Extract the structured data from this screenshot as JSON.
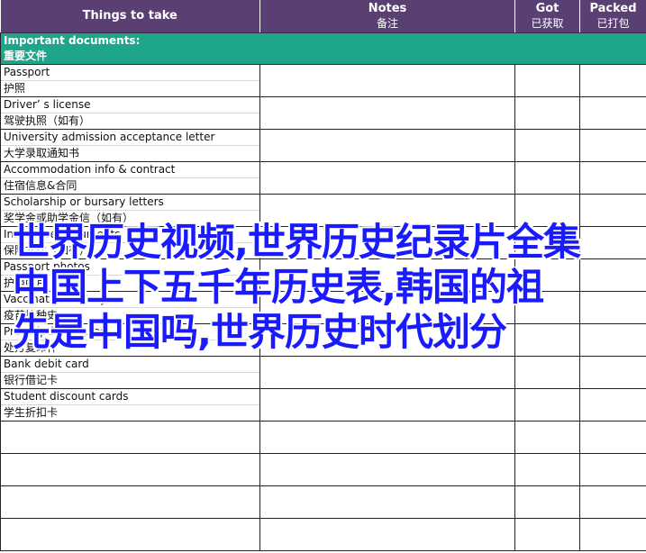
{
  "header": {
    "col1": "Things to take",
    "col2": "Notes",
    "col2_zh": "备注",
    "col3": "Got",
    "col3_zh": "已获取",
    "col4": "Packed",
    "col4_zh": "已打包"
  },
  "section": {
    "title": "Important documents:",
    "title_zh": "重要文件"
  },
  "items": [
    {
      "en": "Passport",
      "zh": "护照"
    },
    {
      "en": "Driver’ s license",
      "zh": "驾驶执照（如有）"
    },
    {
      "en": "University admission acceptance letter",
      "zh": "大学录取通知书"
    },
    {
      "en": "Accommodation info & contract",
      "zh": "住宿信息&合同"
    },
    {
      "en": "Scholarship or bursary letters",
      "zh": "奖学金或助学金信（如有）"
    },
    {
      "en": "Insurance documents",
      "zh": "保险文件（如有）"
    },
    {
      "en": "Passport photos",
      "zh": "护照照片"
    },
    {
      "en": "Vaccination history",
      "zh": "疫苗接种史"
    },
    {
      "en": "Prescription copies",
      "zh": "处方复印件"
    },
    {
      "en": "Bank debit card",
      "zh": "银行借记卡"
    },
    {
      "en": "Student discount cards",
      "zh": "学生折扣卡"
    }
  ],
  "overlay": {
    "line1": "世界历史视频,世界历史纪录片全集",
    "line2": "中国上下五千年历史表,韩国的祖",
    "line3": "先是中国吗,世界历史时代划分"
  }
}
